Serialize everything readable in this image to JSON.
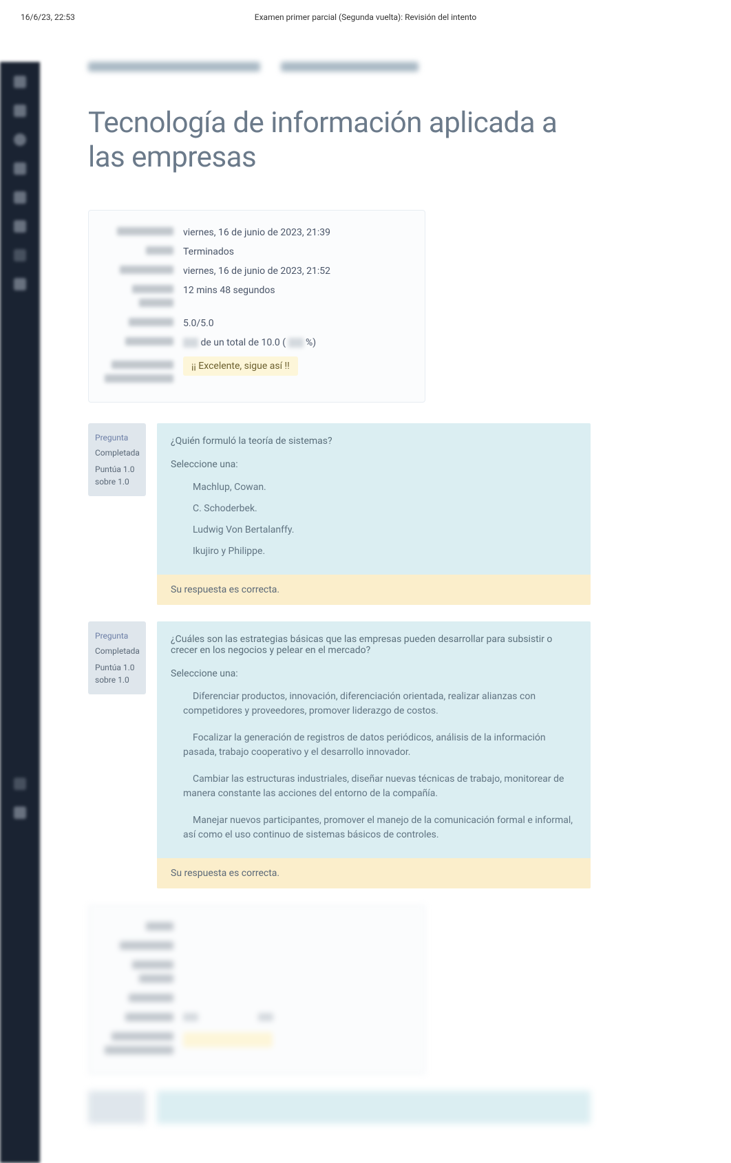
{
  "topbar": {
    "datetime": "16/6/23, 22:53",
    "title": "Examen primer parcial (Segunda vuelta): Revisión del intento"
  },
  "page": {
    "title": "Tecnología de información aplicada a las empresas"
  },
  "summary": {
    "started_value": "viernes, 16 de junio de 2023, 21:39",
    "state_value": "Terminados",
    "completed_value": "viernes, 16 de junio de 2023, 21:52",
    "time_value": "12 mins 48 segundos",
    "marks_value": "5.0/5.0",
    "grade_prefix": " de un total de 10.0 ( ",
    "grade_suffix": " %)",
    "feedback_value": "¡¡ Excelente, sigue así !!"
  },
  "questions": [
    {
      "label": "Pregunta",
      "status": "Completada",
      "marks": "Puntúa 1.0 sobre 1.0",
      "text": "¿Quién formuló la teoría de sistemas?",
      "prompt": "Seleccione una:",
      "options": [
        "Machlup, Cowan.",
        "C. Schoderbek.",
        "Ludwig Von Bertalanffy.",
        "Ikujiro y Philippe."
      ],
      "feedback": "Su respuesta es correcta."
    },
    {
      "label": "Pregunta",
      "status": "Completada",
      "marks": "Puntúa 1.0 sobre 1.0",
      "text": "¿Cuáles son las estrategias básicas que las empresas pueden desarrollar para subsistir o crecer en los negocios y pelear en el mercado?",
      "prompt": "Seleccione una:",
      "options": [
        "Diferenciar productos, innovación, diferenciación orientada, realizar alianzas con competidores y proveedores, promover liderazgo de costos.",
        "Focalizar la generación de registros de datos periódicos, análisis de la información pasada, trabajo cooperativo y el desarrollo innovador.",
        "Cambiar las estructuras industriales, diseñar nuevas técnicas de trabajo, monitorear de manera constante las acciones del entorno de la compañía.",
        "Manejar nuevos participantes, promover el manejo de la comunicación formal e informal, así como el uso continuo de sistemas básicos de controles."
      ],
      "feedback": "Su respuesta es correcta."
    }
  ]
}
